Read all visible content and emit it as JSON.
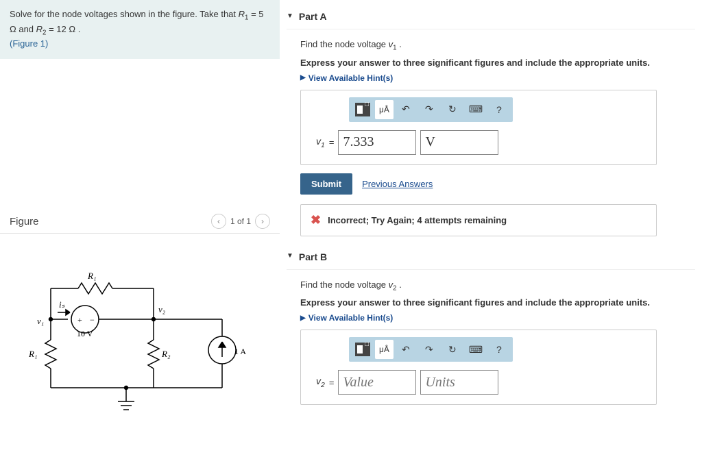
{
  "problem": {
    "statement_pre": "Solve for the node voltages shown in the figure. Take that ",
    "r1_label": "R",
    "r1_sub": "1",
    "r1_val": " = 5 Ω",
    "and": " and ",
    "r2_label": "R",
    "r2_sub": "2",
    "r2_val": " = 12 Ω",
    "period": " .",
    "figure_link": "(Figure 1)"
  },
  "figure_header": {
    "title": "Figure",
    "pager": "1 of 1"
  },
  "circuit": {
    "R1_top": "R₁",
    "R1_left": "R₁",
    "R2": "R₂",
    "Vsrc": "10 V",
    "Isrc": "1 A",
    "v1": "v₁",
    "v2": "v₂",
    "is": "iₛ",
    "plus": "+",
    "minus": "−"
  },
  "partA": {
    "title": "Part A",
    "prompt_pre": "Find the node voltage ",
    "prompt_var": "v",
    "prompt_sub": "1",
    "prompt_post": " .",
    "instr": "Express your answer to three significant figures and include the appropriate units.",
    "hints": "View Available Hint(s)",
    "var_label": "v",
    "var_sub": "1",
    "eq": " = ",
    "value": "7.333",
    "units": "V",
    "submit": "Submit",
    "prev": "Previous Answers",
    "feedback": "Incorrect; Try Again; 4 attempts remaining",
    "ua": "μÅ"
  },
  "partB": {
    "title": "Part B",
    "prompt_pre": "Find the node voltage ",
    "prompt_var": "v",
    "prompt_sub": "2",
    "prompt_post": " .",
    "instr": "Express your answer to three significant figures and include the appropriate units.",
    "hints": "View Available Hint(s)",
    "var_label": "v",
    "var_sub": "2",
    "eq": " = ",
    "value_ph": "Value",
    "units_ph": "Units",
    "ua": "μÅ"
  },
  "icons": {
    "help": "?",
    "undo": "↶",
    "redo": "↷",
    "refresh": "↻",
    "keyboard": "⌨"
  }
}
